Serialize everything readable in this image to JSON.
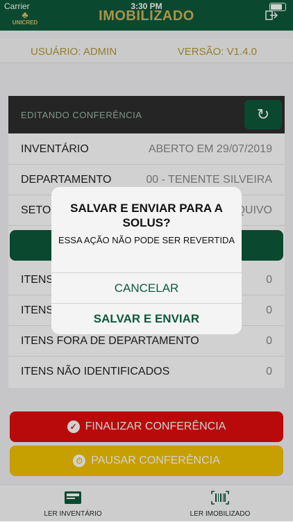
{
  "status": {
    "carrier": "Carrier",
    "time": "3:30 PM"
  },
  "header": {
    "logo_text": "UNICRED",
    "title": "IMOBILIZADO"
  },
  "userbar": {
    "user": "USUÁRIO: ADMIN",
    "version": "VERSÃO: V1.4.0"
  },
  "card": {
    "title": "EDITANDO CONFERÊNCIA",
    "rows": [
      {
        "label": "INVENTÁRIO",
        "value": "ABERTO EM 29/07/2019"
      },
      {
        "label": "DEPARTAMENTO",
        "value": "00 - TENENTE SILVEIRA"
      },
      {
        "label": "SETO",
        "value": "QUIVO"
      }
    ],
    "counts": [
      {
        "label": "ITENS",
        "value": "0"
      },
      {
        "label": "ITENS",
        "value": "0"
      },
      {
        "label": "ITENS FORA DE DEPARTAMENTO",
        "value": "0"
      },
      {
        "label": "ITENS NÃO IDENTIFICADOS",
        "value": "0"
      }
    ]
  },
  "actions": {
    "finalize": "FINALIZAR CONFERÊNCIA",
    "pause": "PAUSAR CONFERÊNCIA"
  },
  "tabs": {
    "read_inventory": "LER INVENTÁRIO",
    "read_asset": "LER IMOBILIZADO"
  },
  "dialog": {
    "title": "SALVAR E ENVIAR PARA A SOLUS?",
    "message": "ESSA AÇÃO NÃO PODE SER REVERTIDA",
    "cancel": "CANCELAR",
    "confirm": "SALVAR E ENVIAR"
  },
  "colors": {
    "primary": "#0d5a3b",
    "gold": "#b59a3b",
    "danger": "#e10d0d",
    "warning": "#f2c300"
  }
}
